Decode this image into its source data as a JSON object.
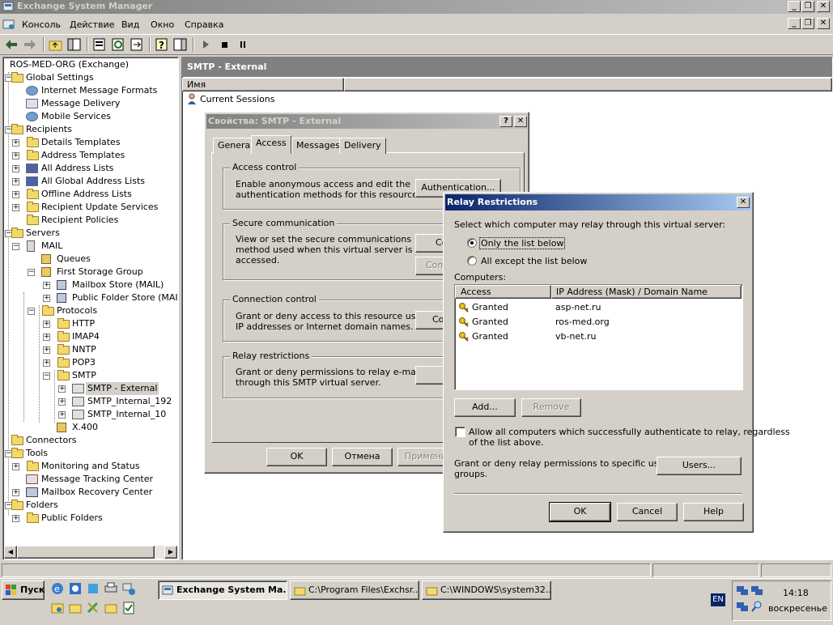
{
  "app": {
    "title": "Exchange System Manager",
    "menu": [
      "Консоль",
      "Действие",
      "Вид",
      "Окно",
      "Справка"
    ]
  },
  "tree": {
    "root": "ROS-MED-ORG (Exchange)",
    "items": [
      "Global Settings",
      "Internet Message Formats",
      "Message Delivery",
      "Mobile Services",
      "Recipients",
      "Details Templates",
      "Address Templates",
      "All Address Lists",
      "All Global Address Lists",
      "Offline Address Lists",
      "Recipient Update Services",
      "Recipient Policies",
      "Servers",
      "MAIL",
      "Queues",
      "First Storage Group",
      "Mailbox Store (MAIL)",
      "Public Folder Store (MAIL)",
      "Protocols",
      "HTTP",
      "IMAP4",
      "NNTP",
      "POP3",
      "SMTP",
      "SMTP - External",
      "SMTP_Internal_192",
      "SMTP_Internal_10",
      "X.400",
      "Connectors",
      "Tools",
      "Monitoring and Status",
      "Message Tracking Center",
      "Mailbox Recovery Center",
      "Folders",
      "Public Folders"
    ]
  },
  "rightPane": {
    "header": "SMTP - External",
    "column": "Имя",
    "row": "Current Sessions"
  },
  "props": {
    "title": "Свойства: SMTP - External",
    "tabs": [
      "General",
      "Access",
      "Messages",
      "Delivery"
    ],
    "access_control": {
      "legend": "Access control",
      "text1": "Enable anonymous access and edit the",
      "text2": "authentication methods for this resource.",
      "button": "Authentication..."
    },
    "secure": {
      "legend": "Secure communication",
      "text1": "View or set the secure communications",
      "text2": "method used when this virtual server is",
      "text3": "accessed.",
      "button1": "Ce",
      "button2": "Com"
    },
    "connection": {
      "legend": "Connection control",
      "text1": "Grant or deny access to this resource using",
      "text2": "IP addresses or Internet domain names.",
      "button": "Co"
    },
    "relay": {
      "legend": "Relay restrictions",
      "text1": "Grant or deny permissions to relay e-mail",
      "text2": "through this SMTP virtual server."
    },
    "ok": "OK",
    "cancel": "Отмена",
    "apply": "Примени"
  },
  "relay": {
    "title": "Relay Restrictions",
    "select_label": "Select which computer may relay through this virtual server:",
    "radio_only": "Only the list below",
    "radio_all": "All except the list below",
    "computers_label": "Computers:",
    "columns": [
      "Access",
      "IP Address (Mask) / Domain Name"
    ],
    "rows": [
      {
        "access": "Granted",
        "address": "asp-net.ru"
      },
      {
        "access": "Granted",
        "address": "ros-med.org"
      },
      {
        "access": "Granted",
        "address": "vb-net.ru"
      }
    ],
    "add": "Add...",
    "remove": "Remove",
    "allow_text1": "Allow all computers which successfully authenticate to relay, regardless",
    "allow_text2": "of the list above.",
    "grant_text1": "Grant or deny relay permissions to specific users or",
    "grant_text2": "groups.",
    "users": "Users...",
    "ok": "OK",
    "cancel": "Cancel",
    "help": "Help"
  },
  "taskbar": {
    "start": "Пуск",
    "buttons": [
      "Exchange System Ma...",
      "C:\\Program Files\\Exchsr...",
      "C:\\WINDOWS\\system32..."
    ],
    "lang": "EN",
    "time": "14:18",
    "day": "воскресенье"
  }
}
